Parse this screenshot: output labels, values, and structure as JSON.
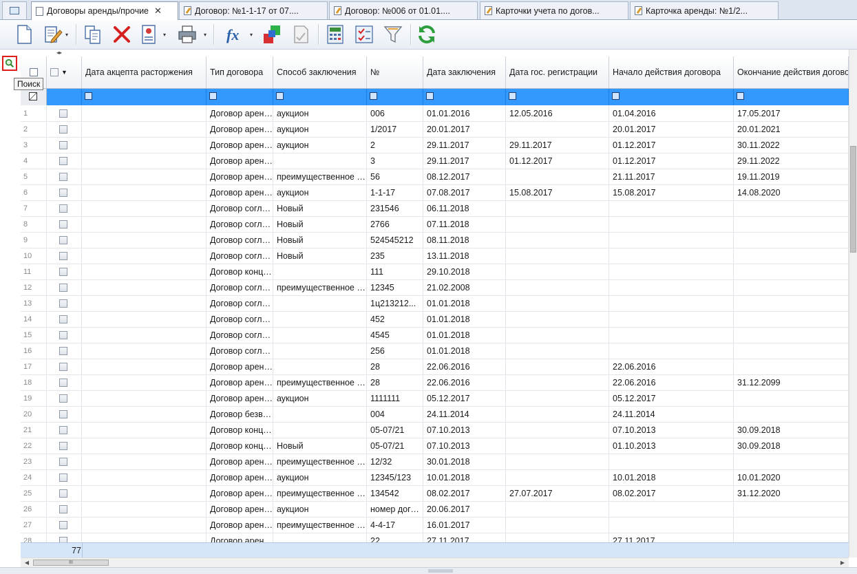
{
  "tabs": [
    {
      "label": "",
      "icon": "list-icon"
    },
    {
      "label": "Договоры аренды/прочие",
      "icon": "document-icon",
      "active": true,
      "closable": true
    },
    {
      "label": "Договор: №1-1-17 от 07....",
      "icon": "edit-document-icon"
    },
    {
      "label": "Договор: №006 от 01.01....",
      "icon": "edit-document-icon"
    },
    {
      "label": "Карточки учета по догов...",
      "icon": "edit-document-icon"
    },
    {
      "label": "Карточка аренды: №1/2...",
      "icon": "edit-document-icon"
    }
  ],
  "tab_close_glyph": "✕",
  "toolbar": {
    "buttons": [
      "new-document-icon",
      "edit-icon",
      "copy-icon",
      "delete-icon",
      "card-icon",
      "print-icon",
      "formula-icon",
      "colored-squares-icon",
      "sign-document-icon",
      "calculator-icon",
      "checklist-icon",
      "filter-funnel-icon",
      "refresh-icon"
    ],
    "dropdown_glyph": "▾"
  },
  "tooltip": "Поиск",
  "columns": [
    "Дата акцепта расторжения",
    "Тип договора",
    "Способ заключения",
    "№",
    "Дата заключения",
    "Дата гос. регистрации",
    "Начало действия договора",
    "Окончание действия договора"
  ],
  "rows": [
    {
      "n": "1",
      "a": "",
      "t": "Договор аренды",
      "s": "аукцион",
      "no": "006",
      "dz": "01.01.2016",
      "dr": "12.05.2016",
      "start": "01.04.2016",
      "end": "17.05.2017"
    },
    {
      "n": "2",
      "a": "",
      "t": "Договор аренды",
      "s": "аукцион",
      "no": "1/2017",
      "dz": "20.01.2017",
      "dr": "",
      "start": "20.01.2017",
      "end": "20.01.2021"
    },
    {
      "n": "3",
      "a": "",
      "t": "Договор аренды",
      "s": "аукцион",
      "no": "2",
      "dz": "29.11.2017",
      "dr": "29.11.2017",
      "start": "01.12.2017",
      "end": "30.11.2022"
    },
    {
      "n": "4",
      "a": "",
      "t": "Договор аренды",
      "s": "",
      "no": "3",
      "dz": "29.11.2017",
      "dr": "01.12.2017",
      "start": "01.12.2017",
      "end": "29.11.2022"
    },
    {
      "n": "5",
      "a": "",
      "t": "Договор аренды",
      "s": "преимущественное право",
      "no": "56",
      "dz": "08.12.2017",
      "dr": "",
      "start": "21.11.2017",
      "end": "19.11.2019"
    },
    {
      "n": "6",
      "a": "",
      "t": "Договор аренды",
      "s": "аукцион",
      "no": "1-1-17",
      "dz": "07.08.2017",
      "dr": "15.08.2017",
      "start": "15.08.2017",
      "end": "14.08.2020"
    },
    {
      "n": "7",
      "a": "",
      "t": "Договор соглашения",
      "s": "Новый",
      "no": "231546",
      "dz": "06.11.2018",
      "dr": "",
      "start": "",
      "end": ""
    },
    {
      "n": "8",
      "a": "",
      "t": "Договор соглашения",
      "s": "Новый",
      "no": "2766",
      "dz": "07.11.2018",
      "dr": "",
      "start": "",
      "end": ""
    },
    {
      "n": "9",
      "a": "",
      "t": "Договор соглашения",
      "s": "Новый",
      "no": "524545212",
      "dz": "08.11.2018",
      "dr": "",
      "start": "",
      "end": ""
    },
    {
      "n": "10",
      "a": "",
      "t": "Договор соглашения",
      "s": "Новый",
      "no": "235",
      "dz": "13.11.2018",
      "dr": "",
      "start": "",
      "end": ""
    },
    {
      "n": "11",
      "a": "",
      "t": "Договор концессии",
      "s": "",
      "no": "111",
      "dz": "29.10.2018",
      "dr": "",
      "start": "",
      "end": ""
    },
    {
      "n": "12",
      "a": "",
      "t": "Договор соглашения",
      "s": "преимущественное право",
      "no": "12345",
      "dz": "21.02.2008",
      "dr": "",
      "start": "",
      "end": ""
    },
    {
      "n": "13",
      "a": "",
      "t": "Договор соглашения",
      "s": "",
      "no": "1ц213212...",
      "dz": "01.01.2018",
      "dr": "",
      "start": "",
      "end": ""
    },
    {
      "n": "14",
      "a": "",
      "t": "Договор соглашения",
      "s": "",
      "no": "452",
      "dz": "01.01.2018",
      "dr": "",
      "start": "",
      "end": ""
    },
    {
      "n": "15",
      "a": "",
      "t": "Договор соглашения",
      "s": "",
      "no": "4545",
      "dz": "01.01.2018",
      "dr": "",
      "start": "",
      "end": ""
    },
    {
      "n": "16",
      "a": "",
      "t": "Договор соглашения",
      "s": "",
      "no": "256",
      "dz": "01.01.2018",
      "dr": "",
      "start": "",
      "end": ""
    },
    {
      "n": "17",
      "a": "",
      "t": "Договор аренды",
      "s": "",
      "no": "28",
      "dz": "22.06.2016",
      "dr": "",
      "start": "22.06.2016",
      "end": ""
    },
    {
      "n": "18",
      "a": "",
      "t": "Договор аренды",
      "s": "преимущественное право",
      "no": "28",
      "dz": "22.06.2016",
      "dr": "",
      "start": "22.06.2016",
      "end": "31.12.2099"
    },
    {
      "n": "19",
      "a": "",
      "t": "Договор аренды",
      "s": "аукцион",
      "no": "1111111",
      "dz": "05.12.2017",
      "dr": "",
      "start": "05.12.2017",
      "end": ""
    },
    {
      "n": "20",
      "a": "",
      "t": "Договор безвозмездного",
      "s": "",
      "no": "004",
      "dz": "24.11.2014",
      "dr": "",
      "start": "24.11.2014",
      "end": ""
    },
    {
      "n": "21",
      "a": "",
      "t": "Договор концессии",
      "s": "",
      "no": "05-07/21",
      "dz": "07.10.2013",
      "dr": "",
      "start": "07.10.2013",
      "end": "30.09.2018"
    },
    {
      "n": "22",
      "a": "",
      "t": "Договор концессии",
      "s": "Новый",
      "no": "05-07/21",
      "dz": "07.10.2013",
      "dr": "",
      "start": "01.10.2013",
      "end": "30.09.2018"
    },
    {
      "n": "23",
      "a": "",
      "t": "Договор аренды",
      "s": "преимущественное право",
      "no": "12/32",
      "dz": "30.01.2018",
      "dr": "",
      "start": "",
      "end": ""
    },
    {
      "n": "24",
      "a": "",
      "t": "Договор аренды",
      "s": "аукцион",
      "no": "12345/123",
      "dz": "10.01.2018",
      "dr": "",
      "start": "10.01.2018",
      "end": "10.01.2020"
    },
    {
      "n": "25",
      "a": "",
      "t": "Договор аренды",
      "s": "преимущественное право",
      "no": "134542",
      "dz": "08.02.2017",
      "dr": "27.07.2017",
      "start": "08.02.2017",
      "end": "31.12.2020"
    },
    {
      "n": "26",
      "a": "",
      "t": "Договор аренды",
      "s": "аукцион",
      "no": "номер договора",
      "dz": "20.06.2017",
      "dr": "",
      "start": "",
      "end": ""
    },
    {
      "n": "27",
      "a": "",
      "t": "Договор аренды",
      "s": "преимущественное право",
      "no": "4-4-17",
      "dz": "16.01.2017",
      "dr": "",
      "start": "",
      "end": ""
    },
    {
      "n": "28",
      "a": "",
      "t": "Договор аренды",
      "s": "",
      "no": "22",
      "dz": "27.11.2017",
      "dr": "",
      "start": "27.11.2017",
      "end": ""
    }
  ],
  "footer": {
    "count": "77"
  },
  "scrollbar": {
    "thumb_glyph": "III",
    "left_glyph": "◀",
    "right_glyph": "▶"
  },
  "colors": {
    "selected_row": "#3399ff",
    "footer": "#d5e6fb",
    "search_highlight": "#e01b1b"
  }
}
